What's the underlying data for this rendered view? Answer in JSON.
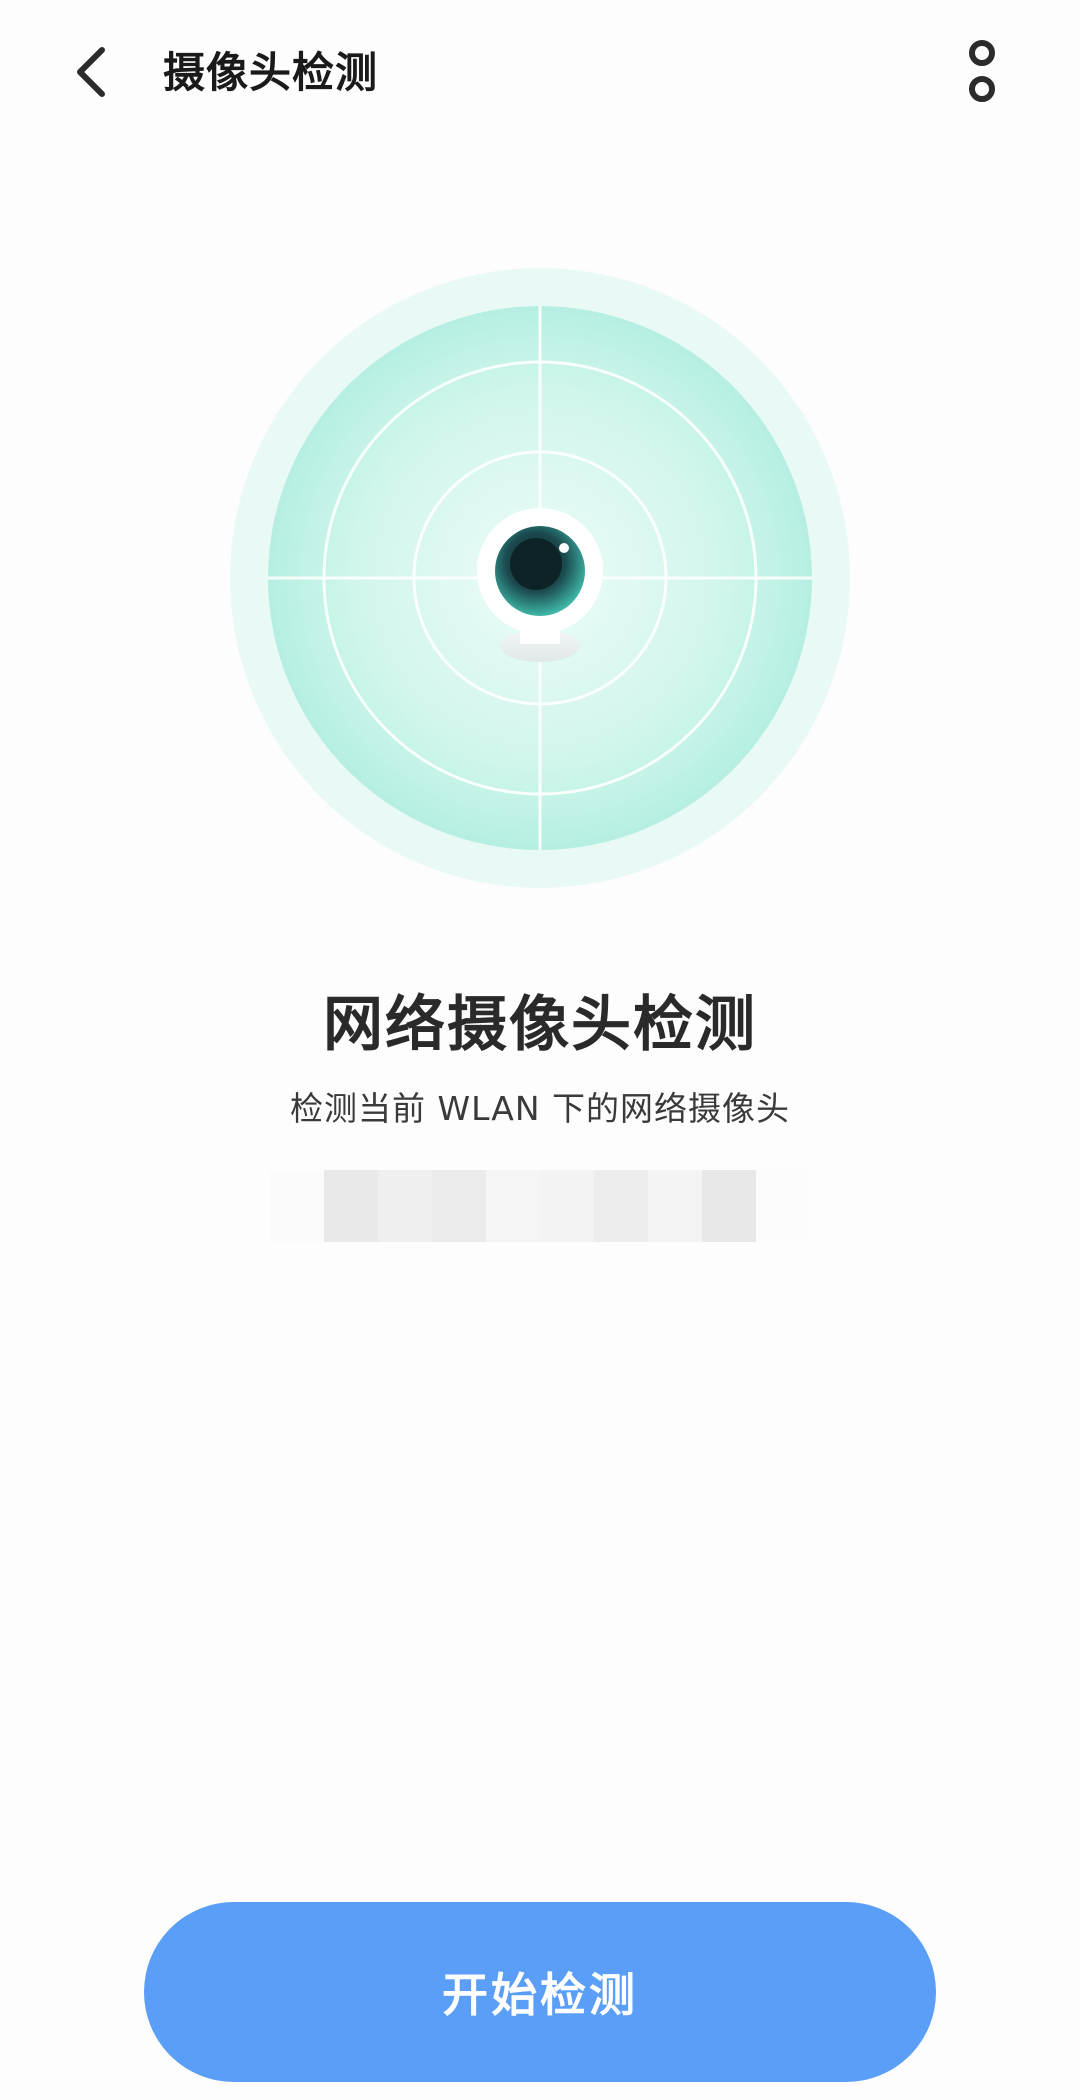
{
  "header": {
    "title": "摄像头检测",
    "back_icon": "chevron-left-icon",
    "more_icon": "more-vertical-icon"
  },
  "illustration": {
    "icon": "camera-icon",
    "colors": {
      "outer": "#e9f9f5",
      "inner": "#bff2e6",
      "lines": "#ffffff",
      "lens": "#1e4f55"
    }
  },
  "main": {
    "heading": "网络摄像头检测",
    "description": "检测当前 WLAN 下的网络摄像头"
  },
  "footer": {
    "start_label": "开始检测",
    "button_color": "#5a9ef8"
  }
}
